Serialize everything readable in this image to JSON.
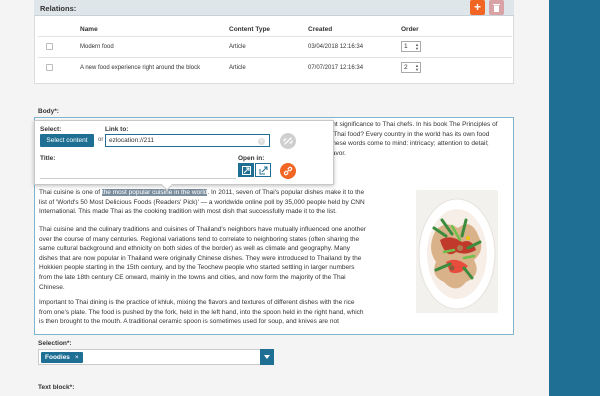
{
  "relations": {
    "title": "Relations:",
    "columns": {
      "name": "Name",
      "content_type": "Content Type",
      "created": "Created",
      "order": "Order"
    },
    "rows": [
      {
        "name": "Modern food",
        "content_type": "Article",
        "created": "03/04/2018 12:16:34",
        "order": "1"
      },
      {
        "name": "A new food experience right around the block",
        "content_type": "Article",
        "created": "07/07/2017 12:16:34",
        "order": "2"
      }
    ]
  },
  "body": {
    "label": "Body*:",
    "top_lines": [
      "amount significance to Thai chefs. In his book The Principles of",
      "hat is Thai food? Every country in the world has its own food",
      "and, these words come to mind: intricacy; attention to detail;",
      "ood flavor."
    ],
    "para1_before": "Thai cuisine is one of ",
    "para1_highlight": "the most popular cuisine in the world",
    "para1_after_first_line": ". In 2011, seven of Thai's popular dishes make it to the",
    "para1_lines": [
      "list of 'World's 50 Most Delicious Foods (Readers' Pick)' — a worldwide online poll by 35,000 people held by CNN",
      "International. This made Thai as the cooking tradition with most dish that successfully made it to the list."
    ],
    "para2_lines": [
      "Thai cuisine and the culinary traditions and cuisines of Thailand's neighbors have mutually influenced one another",
      "over the course of many centuries. Regional variations tend to correlate to neighboring states (often sharing the",
      "same cultural background and ethnicity on both sides of the border) as well as climate and geography. Many",
      "dishes that are now popular in Thailand were originally Chinese dishes. They were introduced to Thailand by the",
      "Hokkien people starting in the 15th century, and by the Teochew people who started settling in larger numbers",
      "from the late 18th century CE onward, mainly in the towns and cities, and now form the majority of the Thai",
      "Chinese."
    ],
    "para3_lines": [
      "Important to Thai dining is the practice of khluk, mixing the flavors and textures of different dishes with the rice",
      "from one's plate. The food is pushed by the fork, held in the left hand, into the spoon held in the right hand, which",
      "is then brought to the mouth. A traditional ceramic spoon is sometimes used for soup, and knives are not"
    ]
  },
  "link_popup": {
    "select_label": "Select:",
    "select_button": "Select content",
    "or_text": "or",
    "link_to_label": "Link to:",
    "link_value": "ezlocation://211",
    "title_label": "Title:",
    "title_value": "",
    "open_in_label": "Open in:"
  },
  "selection": {
    "label": "Selection*:",
    "tag": "Foodies",
    "tag_remove": "×"
  },
  "text_block": {
    "label": "Text block*:"
  },
  "colors": {
    "accent": "#1f6f94",
    "orange": "#f26522",
    "highlight": "#7b8e9e"
  }
}
